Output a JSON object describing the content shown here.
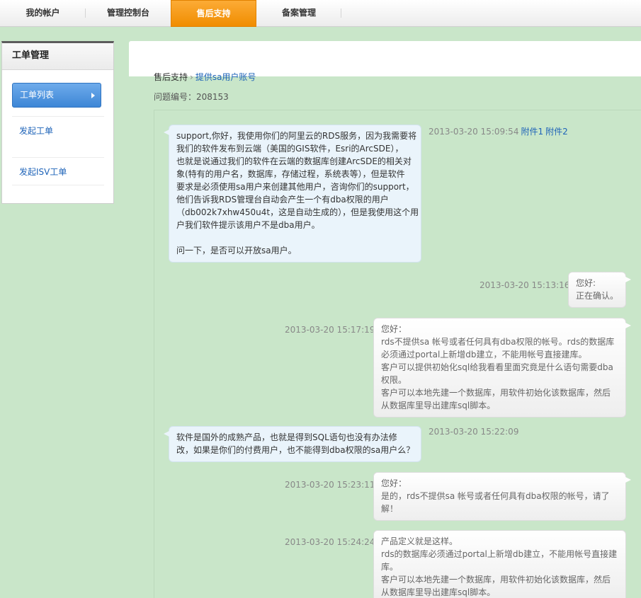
{
  "nav": {
    "tabs": [
      {
        "label": "我的帐户"
      },
      {
        "label": "管理控制台"
      },
      {
        "label": "售后支持"
      },
      {
        "label": "备案管理"
      }
    ]
  },
  "sidebar": {
    "title": "工单管理",
    "items": [
      {
        "label": "工单列表"
      },
      {
        "label": "发起工单"
      },
      {
        "label": "发起ISV工单"
      }
    ]
  },
  "breadcrumb": {
    "parent": "售后支持",
    "separator": "›",
    "current": "提供sa用户账号"
  },
  "issue": {
    "label": "问题编号：208153"
  },
  "messages": [
    {
      "time": "2013-03-20 15:09:54",
      "attachments": [
        "附件1",
        "附件2"
      ],
      "lines": [
        "support,你好，我使用你们的阿里云的RDS服务，因为我需要将",
        "我们的软件发布到云端（美国的GIS软件，Esri的ArcSDE），",
        "也就是说通过我们的软件在云端的数据库创建ArcSDE的相关对",
        "象(特有的用户名，数据库，存储过程，系统表等），但是软件",
        "要求是必须使用sa用户来创建其他用户，咨询你们的support，",
        "他们告诉我RDS管理台自动会产生一个有dba权限的用户",
        "（db002k7xhw450u4t，这是自动生成的），但是我使用这个用",
        "户我们软件提示该用户不是dba用户。",
        "",
        "问一下，是否可以开放sa用户。"
      ]
    },
    {
      "time": "2013-03-20 15:13:16",
      "lines": [
        "您好:",
        "正在确认。"
      ]
    },
    {
      "time": "2013-03-20 15:17:19",
      "lines": [
        "您好：",
        "rds不提供sa 帐号或者任何具有dba权限的帐号。rds的数据库",
        "必须通过portal上新增db建立，不能用帐号直接建库。",
        "客户可以提供初始化sql给我看看里面究竟是什么语句需要dba",
        "权限。",
        "客户可以本地先建一个数据库，用软件初始化该数据库，然后",
        "从数据库里导出建库sql脚本。"
      ]
    },
    {
      "time": "2013-03-20 15:22:09",
      "lines": [
        "软件是国外的成熟产品，也就是得到SQL语句也没有办法修",
        "改，如果是你们的付费用户，也不能得到dba权限的sa用户么？"
      ]
    },
    {
      "time": "2013-03-20 15:23:11",
      "lines": [
        "您好：",
        "是的，rds不提供sa 帐号或者任何具有dba权限的帐号，请了",
        "解！"
      ]
    },
    {
      "time": "2013-03-20 15:24:24",
      "lines": [
        "产品定义就是这样。",
        "rds的数据库必须通过portal上新增db建立，不能用帐号直接建",
        "库。",
        "客户可以本地先建一个数据库，用软件初始化该数据库，然后",
        "从数据库里导出建库sql脚本。"
      ]
    }
  ]
}
